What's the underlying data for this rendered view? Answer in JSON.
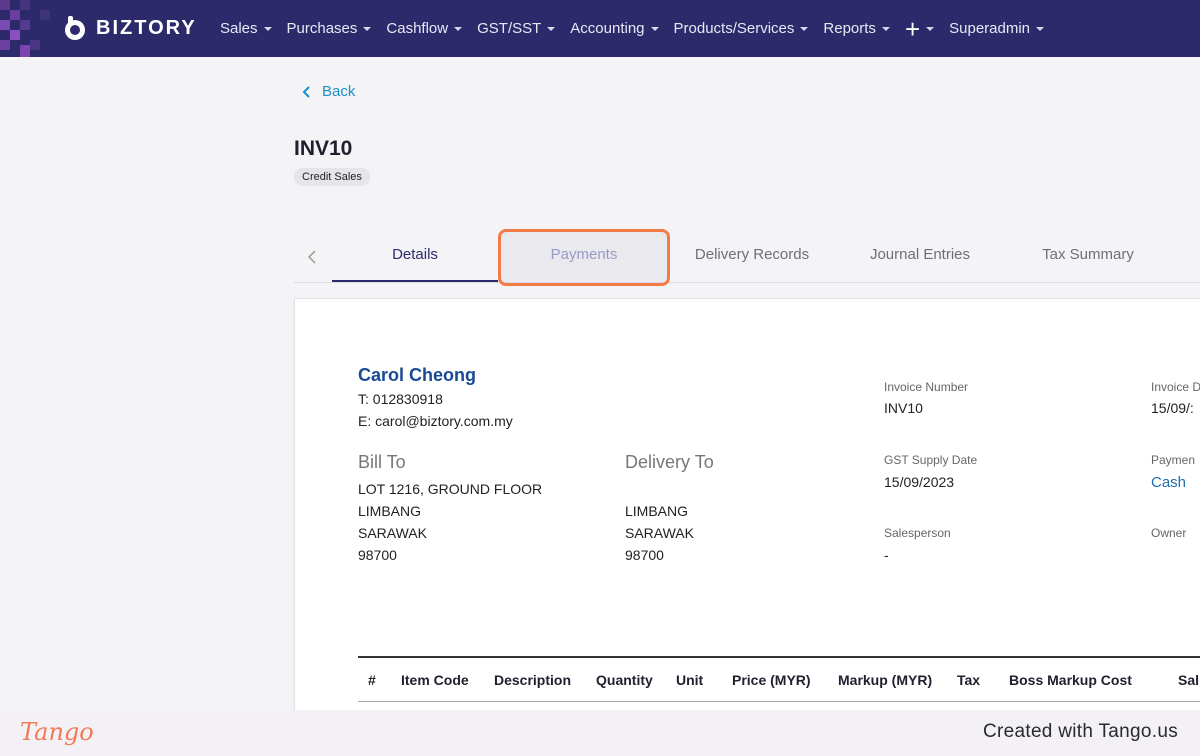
{
  "nav": {
    "brand": "BIZTORY",
    "menu": [
      {
        "label": "Sales"
      },
      {
        "label": "Purchases"
      },
      {
        "label": "Cashflow"
      },
      {
        "label": "GST/SST"
      },
      {
        "label": "Accounting"
      },
      {
        "label": "Products/Services"
      },
      {
        "label": "Reports"
      }
    ],
    "plus_label": "+",
    "user_label": "Superadmin"
  },
  "back_label": "Back",
  "document": {
    "title": "INV10",
    "badge": "Credit Sales"
  },
  "tabs": [
    "Details",
    "Payments",
    "Delivery Records",
    "Journal Entries",
    "Tax Summary"
  ],
  "active_tab": "Details",
  "customer": {
    "name": "Carol Cheong",
    "phone": "T: 012830918",
    "email": "E: carol@biztory.com.my"
  },
  "bill_to": {
    "heading": "Bill To",
    "lines": [
      "LOT 1216, GROUND FLOOR",
      "LIMBANG",
      "SARAWAK",
      "98700"
    ]
  },
  "delivery_to": {
    "heading": "Delivery To",
    "lines": [
      "LIMBANG",
      "SARAWAK",
      "98700"
    ]
  },
  "meta": {
    "invoice_number_label": "Invoice Number",
    "invoice_number": "INV10",
    "invoice_date_label": "Invoice D",
    "invoice_date": "15/09/:",
    "supply_date_label": "GST Supply Date",
    "supply_date": "15/09/2023",
    "payment_label": "Paymen",
    "payment_value": "Cash",
    "salesperson_label": "Salesperson",
    "salesperson": "-",
    "owner_label": "Owner"
  },
  "table_headers": [
    "#",
    "Item Code",
    "Description",
    "Quantity",
    "Unit",
    "Price (MYR)",
    "Markup (MYR)",
    "Tax",
    "Boss Markup Cost",
    "Sal"
  ],
  "footer": {
    "logo": "Tango",
    "text": "Created with Tango.us"
  },
  "colors": {
    "nav_bg": "#2d2a6b",
    "link": "#1a8fc9",
    "customer_name": "#184a93",
    "highlight": "#f37b4a"
  }
}
